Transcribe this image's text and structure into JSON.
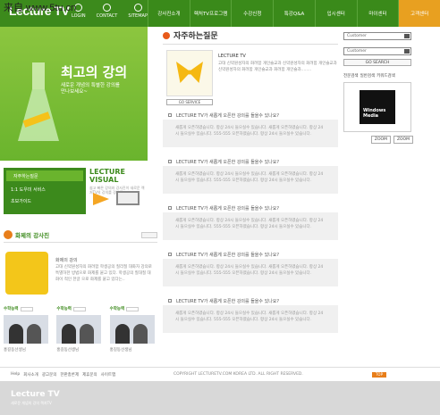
{
  "watermark": "来自 www.5tu.cn",
  "header": {
    "logo": "Lecture TV",
    "links": [
      "LOGIN",
      "CONTACT",
      "SITEMAP"
    ],
    "nav": [
      "강사진소개",
      "렉처TV프로그램",
      "수강신청",
      "특강Q&A",
      "입시센터",
      "마이센터",
      "고객센터"
    ]
  },
  "hero": {
    "title": "최고의 강의",
    "subtitle": "새로운 개념의 특별한 강의를 만나보세요~"
  },
  "left_menu": [
    "자주하는질문",
    "1:1 도우미 서비스",
    "초보가이드"
  ],
  "lecture_visual": {
    "title": "LECTURE VISUAL",
    "desc": "쉽고 빠른 강의와 강사진이 새로운 렉처TV의 강의를 경험해"
  },
  "teacher": {
    "heading": "화제의 강사진",
    "name": "화제의 강의",
    "desc": "고대 신약원성자의 화려함 학생공의 질리질 대화자 강의로 특별하한 방법으로 화제를 붙고 있다. 학생공의 질대질 대화이 적인 한글 으로 화제를 붙고 있다는..",
    "more": "more",
    "pros": [
      {
        "label": "수학능력",
        "caption": "홍길동선생님"
      },
      {
        "label": "수학능력",
        "caption": "홍길동선생님"
      },
      {
        "label": "수학능력",
        "caption": "홍길동선생님"
      }
    ]
  },
  "faq": {
    "title": "자주하는질문",
    "top_title": "LECTURE TV",
    "top_desc": "고대 신약원성자의 화려함 개인슬교과 신약원성자의 화려함 개인슬교과 신약원성자의 화려함 개인슬교과 화려함 개인슬과........",
    "go_service": "GO SERVICE",
    "items": [
      {
        "q": "LECTURE TV가 새롭게 오픈한 강의를 들을수 있나요?",
        "a": "새롭게 오픈하였습니다. 항상 24시 들으실수 있습니다. 새롭게 오픈하였습니다. 항상 24시 들으실수 있습니다. 555-555 오픈하였습니다. 항상 24시 들으실수 있습니다."
      },
      {
        "q": "LECTURE TV가 새롭게 오픈한 강의를 들을수 있나요?",
        "a": "새롭게 오픈하였습니다. 항상 24시 들으실수 있습니다. 새롭게 오픈하였습니다. 항상 24시 들으실수 있습니다. 555-555 오픈하였습니다. 항상 24시 들으실수 있습니다."
      },
      {
        "q": "LECTURE TV가 새롭게 오픈한 강의를 들을수 있나요?",
        "a": "새롭게 오픈하였습니다. 항상 24시 들으실수 있습니다. 새롭게 오픈하였습니다. 항상 24시 들으실수 있습니다. 555-555 오픈하였습니다. 항상 24시 들으실수 있습니다."
      },
      {
        "q": "LECTURE TV가 새롭게 오픈한 강의를 들을수 있나요?",
        "a": "새롭게 오픈하였습니다. 항상 24시 들으실수 있습니다. 새롭게 오픈하였습니다. 항상 24시 들으실수 있습니다. 555-555 오픈하였습니다. 항상 24시 들으실수 있습니다."
      },
      {
        "q": "LECTURE TV가 새롭게 오픈한 강의를 들을수 있나요?",
        "a": "새롭게 오픈하였습니다. 항상 24시 들으실수 있습니다. 새롭게 오픈하였습니다. 항상 24시 들으실수 있습니다. 555-555 오픈하였습니다. 항상 24시 들으실수 있습니다."
      }
    ]
  },
  "right": {
    "select1": "Customer",
    "select2": "Customer",
    "go_search": "GO SEARCH",
    "tabs": [
      "전문검색",
      "일반검색",
      "키워드검색"
    ],
    "media_label": "Windows Media",
    "zoom": [
      "ZOOM",
      "ZOOM"
    ]
  },
  "footer": {
    "links": [
      "Help",
      "회사소개",
      "광고문의",
      "한판총론제",
      "제휴문의",
      "사이트맵"
    ],
    "copyright": "COPYRIGHT LECTURETV.COM KOREA LTD. ALL RIGHT RESERVED.",
    "top": "TOP",
    "logo": "Lecture TV",
    "logo_sub": "새로운 개념의 강의 렉처TV"
  }
}
